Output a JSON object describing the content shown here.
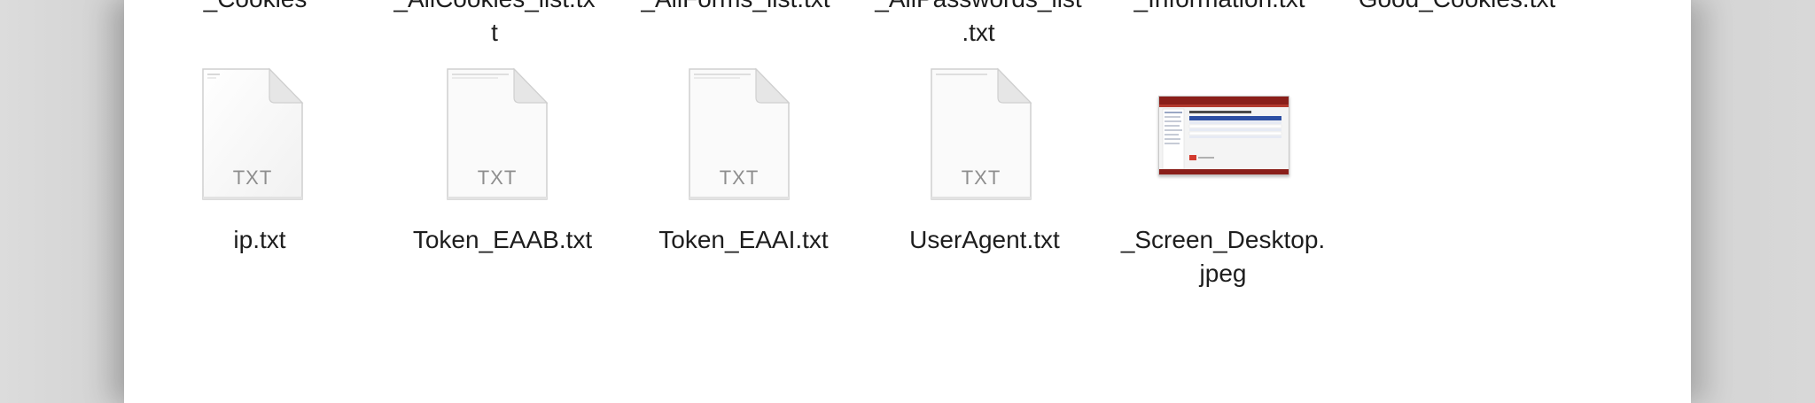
{
  "window": {
    "top_row_partial": [
      {
        "label": "_Cookies"
      },
      {
        "label": "_AllCookies_list.tx\nt"
      },
      {
        "label": "_AllForms_list.txt"
      },
      {
        "label": "_AllPasswords_list\n.txt"
      },
      {
        "label": "_Information.txt"
      },
      {
        "label": "Good_Cookies.txt"
      }
    ],
    "files": [
      {
        "name": "ip.txt",
        "type_badge": "TXT",
        "icon": "text-document-icon"
      },
      {
        "name": "Token_EAAB.txt",
        "type_badge": "TXT",
        "icon": "text-document-icon"
      },
      {
        "name": "Token_EAAI.txt",
        "type_badge": "TXT",
        "icon": "text-document-icon"
      },
      {
        "name": "UserAgent.txt",
        "type_badge": "TXT",
        "icon": "text-document-icon"
      },
      {
        "name": "_Screen_Desktop.\njpeg",
        "type_badge": "",
        "icon": "image-thumbnail-icon"
      }
    ]
  }
}
